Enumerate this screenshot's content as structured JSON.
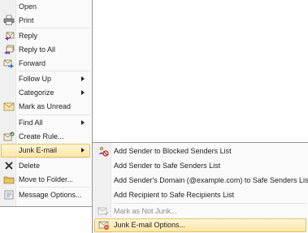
{
  "context_menu": {
    "items": [
      {
        "label": "Open"
      },
      {
        "label": "Print"
      },
      {
        "label": "Reply"
      },
      {
        "label": "Reply to All"
      },
      {
        "label": "Forward"
      },
      {
        "label": "Follow Up"
      },
      {
        "label": "Categorize"
      },
      {
        "label": "Mark as Unread"
      },
      {
        "label": "Find All"
      },
      {
        "label": "Create Rule..."
      },
      {
        "label": "Junk E-mail"
      },
      {
        "label": "Delete"
      },
      {
        "label": "Move to Folder..."
      },
      {
        "label": "Message Options..."
      }
    ]
  },
  "junk_submenu": {
    "items": [
      {
        "label": "Add Sender to Blocked Senders List"
      },
      {
        "label": "Add Sender to Safe Senders List"
      },
      {
        "label": "Add Sender's Domain (@example.com) to Safe Senders List"
      },
      {
        "label": "Add Recipient to Safe Recipients List"
      },
      {
        "label": "Mark as Not Junk..."
      },
      {
        "label": "Junk E-mail Options..."
      }
    ]
  },
  "colors": {
    "highlight_fill": "#fde7a6",
    "highlight_border": "#e5c365",
    "disabled_text": "#8d8d8d"
  }
}
